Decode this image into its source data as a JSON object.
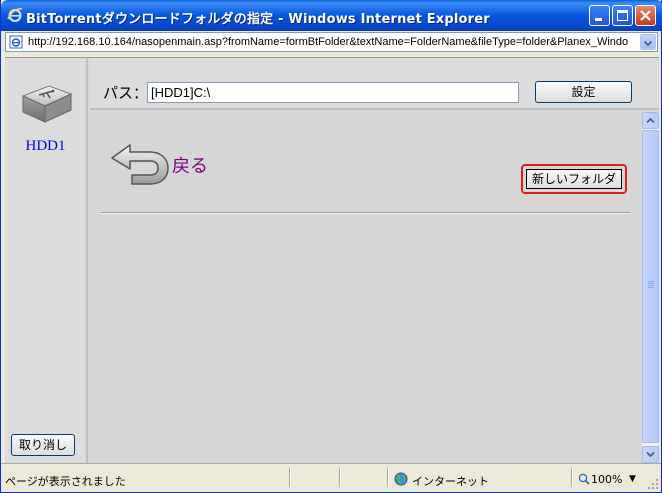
{
  "window": {
    "title": "BitTorrentダウンロードフォルダの指定 - Windows Internet Explorer",
    "address": "http://192.168.10.164/nasopenmain.asp?fromName=formBtFolder&textName=FolderName&fileType=folder&Planex_Windo"
  },
  "sidebar": {
    "drive_label": "HDD1",
    "cancel_label": "取り消し"
  },
  "pathbar": {
    "label": "パス：",
    "value": "[HDD1]C:\\",
    "set_label": "設定"
  },
  "browser": {
    "back_label": "戻る",
    "new_folder_label": "新しいフォルダ"
  },
  "status": {
    "message": "ページが表示されました",
    "zone": "インターネット",
    "zoom": "100%"
  }
}
